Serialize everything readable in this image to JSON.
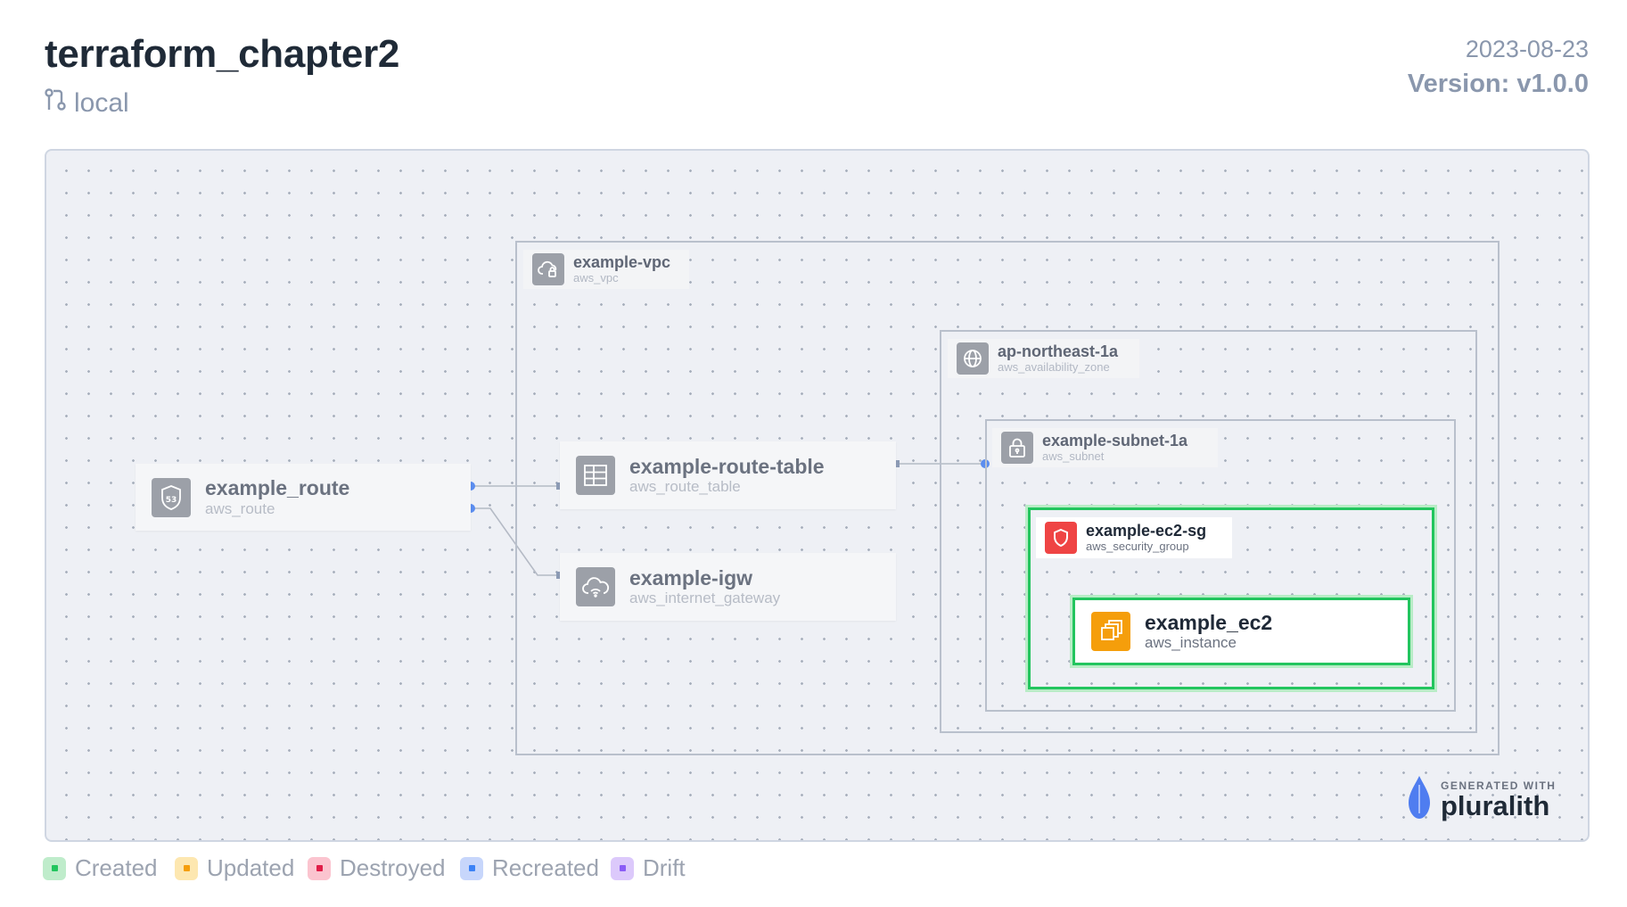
{
  "header": {
    "title": "terraform_chapter2",
    "branch": "local",
    "date": "2023-08-23",
    "version": "Version: v1.0.0"
  },
  "groups": {
    "vpc": {
      "name": "example-vpc",
      "type": "aws_vpc",
      "icon": "cloud-lock-icon"
    },
    "az": {
      "name": "ap-northeast-1a",
      "type": "aws_availability_zone",
      "icon": "globe-icon"
    },
    "subnet": {
      "name": "example-subnet-1a",
      "type": "aws_subnet",
      "icon": "padlock-icon"
    },
    "sg": {
      "name": "example-ec2-sg",
      "type": "aws_security_group",
      "icon": "shield-icon",
      "status": "Created"
    }
  },
  "nodes": {
    "route": {
      "name": "example_route",
      "type": "aws_route",
      "icon": "route53-shield-icon"
    },
    "route_table": {
      "name": "example-route-table",
      "type": "aws_route_table",
      "icon": "table-grid-icon"
    },
    "igw": {
      "name": "example-igw",
      "type": "aws_internet_gateway",
      "icon": "cloud-wifi-icon"
    },
    "ec2": {
      "name": "example_ec2",
      "type": "aws_instance",
      "icon": "ec2-instance-icon",
      "status": "Created"
    }
  },
  "branding": {
    "generated_with": "GENERATED WITH",
    "product": "pluralith"
  },
  "legend": [
    {
      "label": "Created",
      "bg": "#bfeccb",
      "dot": "#22c55e"
    },
    {
      "label": "Updated",
      "bg": "#fde7b0",
      "dot": "#f59e0b"
    },
    {
      "label": "Destroyed",
      "bg": "#fbc4cf",
      "dot": "#e11d48"
    },
    {
      "label": "Recreated",
      "bg": "#c7d6fb",
      "dot": "#3b82f6"
    },
    {
      "label": "Drift",
      "bg": "#dcc9fb",
      "dot": "#8b5cf6"
    }
  ],
  "colors": {
    "created": "#22c55e",
    "ec2_icon": "#f59e0b",
    "sg_icon": "#ef4444",
    "edge_dot": "#5b8def",
    "pluralith_logo": "#4f7df0"
  }
}
